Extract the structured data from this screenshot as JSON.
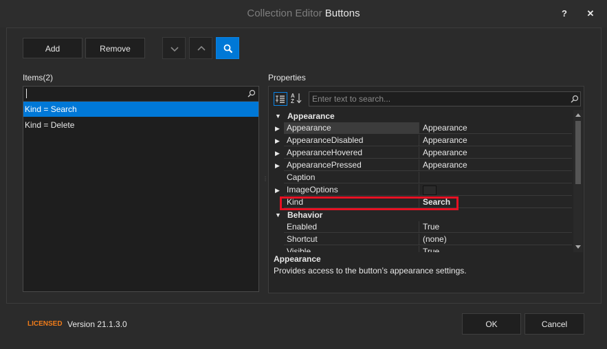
{
  "window": {
    "title_prefix": "Collection Editor",
    "title_main": "Buttons",
    "help_label": "?",
    "close_label": "✕"
  },
  "toolbar": {
    "add_label": "Add",
    "remove_label": "Remove"
  },
  "items": {
    "header": "Items(2)",
    "search_value": "",
    "list": [
      {
        "label": "Kind = Search",
        "selected": true
      },
      {
        "label": "Kind = Delete",
        "selected": false
      }
    ]
  },
  "properties": {
    "header": "Properties",
    "search_placeholder": "Enter text to search...",
    "categories": [
      {
        "name": "Appearance",
        "rows": [
          {
            "name": "Appearance",
            "value": "Appearance",
            "expandable": true,
            "selected": true
          },
          {
            "name": "AppearanceDisabled",
            "value": "Appearance",
            "expandable": true
          },
          {
            "name": "AppearanceHovered",
            "value": "Appearance",
            "expandable": true
          },
          {
            "name": "AppearancePressed",
            "value": "Appearance",
            "expandable": true
          },
          {
            "name": "Caption",
            "value": "",
            "expandable": false
          },
          {
            "name": "ImageOptions",
            "value": "",
            "expandable": true
          },
          {
            "name": "Kind",
            "value": "Search",
            "expandable": false,
            "bold_value": true
          }
        ]
      },
      {
        "name": "Behavior",
        "rows": [
          {
            "name": "Enabled",
            "value": "True",
            "expandable": false
          },
          {
            "name": "Shortcut",
            "value": "(none)",
            "expandable": false
          },
          {
            "name": "Visible",
            "value": "True",
            "expandable": false
          }
        ]
      }
    ],
    "description_title": "Appearance",
    "description_text": "Provides access to the button’s appearance settings."
  },
  "footer": {
    "licensed": "LICENSED",
    "version": "Version 21.1.3.0",
    "ok_label": "OK",
    "cancel_label": "Cancel"
  },
  "colors": {
    "accent": "#0078d7",
    "highlight_border": "#e81123",
    "licensed": "#f07c1a"
  }
}
